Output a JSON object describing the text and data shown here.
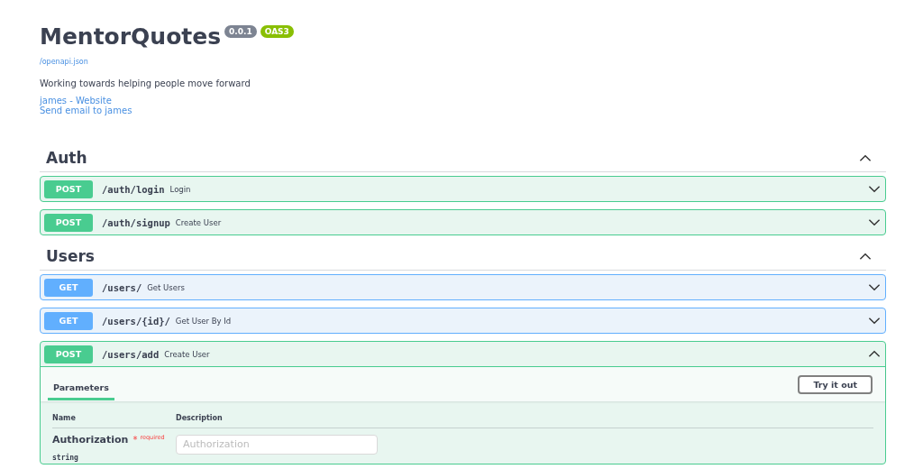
{
  "info": {
    "title": "MentorQuotes",
    "version": "0.0.1",
    "oas": "OAS3",
    "spec_link": "/openapi.json",
    "description": "Working towards helping people move forward",
    "links": [
      "james - Website",
      "Send email to james"
    ]
  },
  "sections": [
    {
      "name": "Auth",
      "expanded": true,
      "operations": [
        {
          "method": "POST",
          "path": "/auth/login",
          "summary": "Login",
          "expanded": false
        },
        {
          "method": "POST",
          "path": "/auth/signup",
          "summary": "Create User",
          "expanded": false
        }
      ]
    },
    {
      "name": "Users",
      "expanded": true,
      "operations": [
        {
          "method": "GET",
          "path": "/users/",
          "summary": "Get Users",
          "expanded": false
        },
        {
          "method": "GET",
          "path": "/users/{id}/",
          "summary": "Get User By Id",
          "expanded": false
        },
        {
          "method": "POST",
          "path": "/users/add",
          "summary": "Create User",
          "expanded": true,
          "panel": {
            "tab": "Parameters",
            "try_button": "Try it out",
            "columns": [
              "Name",
              "Description"
            ],
            "parameters": [
              {
                "name": "Authorization",
                "required_mark": "*",
                "required_label": "required",
                "type": "string",
                "placeholder": "Authorization"
              }
            ]
          }
        }
      ]
    }
  ]
}
